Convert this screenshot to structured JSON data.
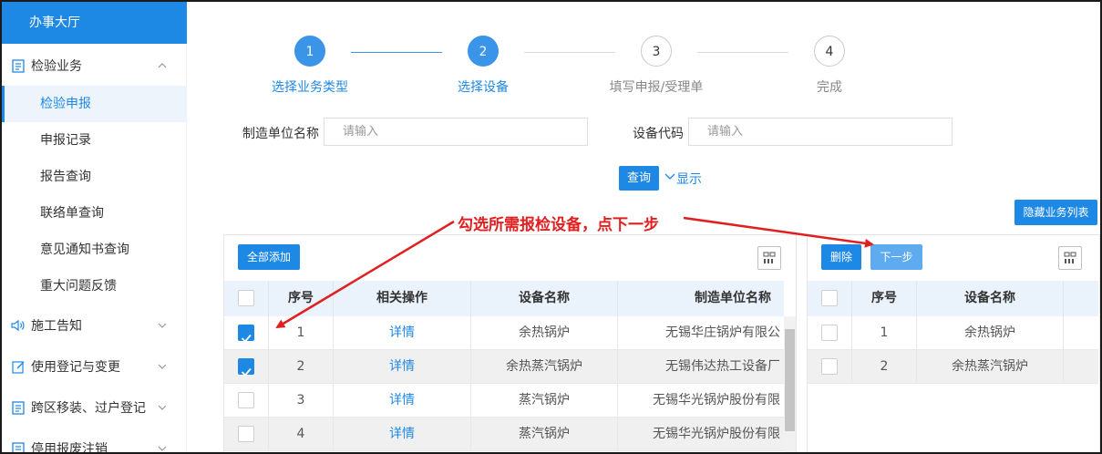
{
  "sidebar": {
    "title": "办事大厅",
    "group_main": "检验业务",
    "items": [
      "检验申报",
      "申报记录",
      "报告查询",
      "联络单查询",
      "意见通知书查询",
      "重大问题反馈"
    ],
    "groups": [
      "施工告知",
      "使用登记与变更",
      "跨区移装、过户登记",
      "停用报废注销"
    ]
  },
  "steps": [
    {
      "num": "1",
      "label": "选择业务类型",
      "state": "done"
    },
    {
      "num": "2",
      "label": "选择设备",
      "state": "active"
    },
    {
      "num": "3",
      "label": "填写申报/受理单",
      "state": "todo"
    },
    {
      "num": "4",
      "label": "完成",
      "state": "todo"
    }
  ],
  "form": {
    "manufacturer_label": "制造单位名称",
    "manufacturer_placeholder": "请输入",
    "device_code_label": "设备代码",
    "device_code_placeholder": "请输入",
    "query_button": "查询",
    "show_toggle": "显示"
  },
  "hide_list_button": "隐藏业务列表",
  "annotation": "勾选所需报检设备，点下一步",
  "left_table": {
    "add_all_button": "全部添加",
    "headers": [
      "序号",
      "相关操作",
      "设备名称",
      "制造单位名称"
    ],
    "rows": [
      {
        "checked": true,
        "no": "1",
        "op": "详情",
        "name": "余热锅炉",
        "maker": "无锡华庄锅炉有限公"
      },
      {
        "checked": true,
        "no": "2",
        "op": "详情",
        "name": "余热蒸汽锅炉",
        "maker": "无锡伟达热工设备厂"
      },
      {
        "checked": false,
        "no": "3",
        "op": "详情",
        "name": "蒸汽锅炉",
        "maker": "无锡华光锅炉股份有限"
      },
      {
        "checked": false,
        "no": "4",
        "op": "详情",
        "name": "蒸汽锅炉",
        "maker": "无锡华光锅炉股份有限"
      }
    ]
  },
  "right_table": {
    "delete_button": "删除",
    "next_button": "下一步",
    "headers": [
      "序号",
      "设备名称"
    ],
    "rows": [
      {
        "no": "1",
        "name": "余热锅炉"
      },
      {
        "no": "2",
        "name": "余热蒸汽锅炉"
      }
    ]
  },
  "colors": {
    "accent": "#1e88e5",
    "annotation": "#e02020",
    "header_bg": "#eaf2fb"
  }
}
